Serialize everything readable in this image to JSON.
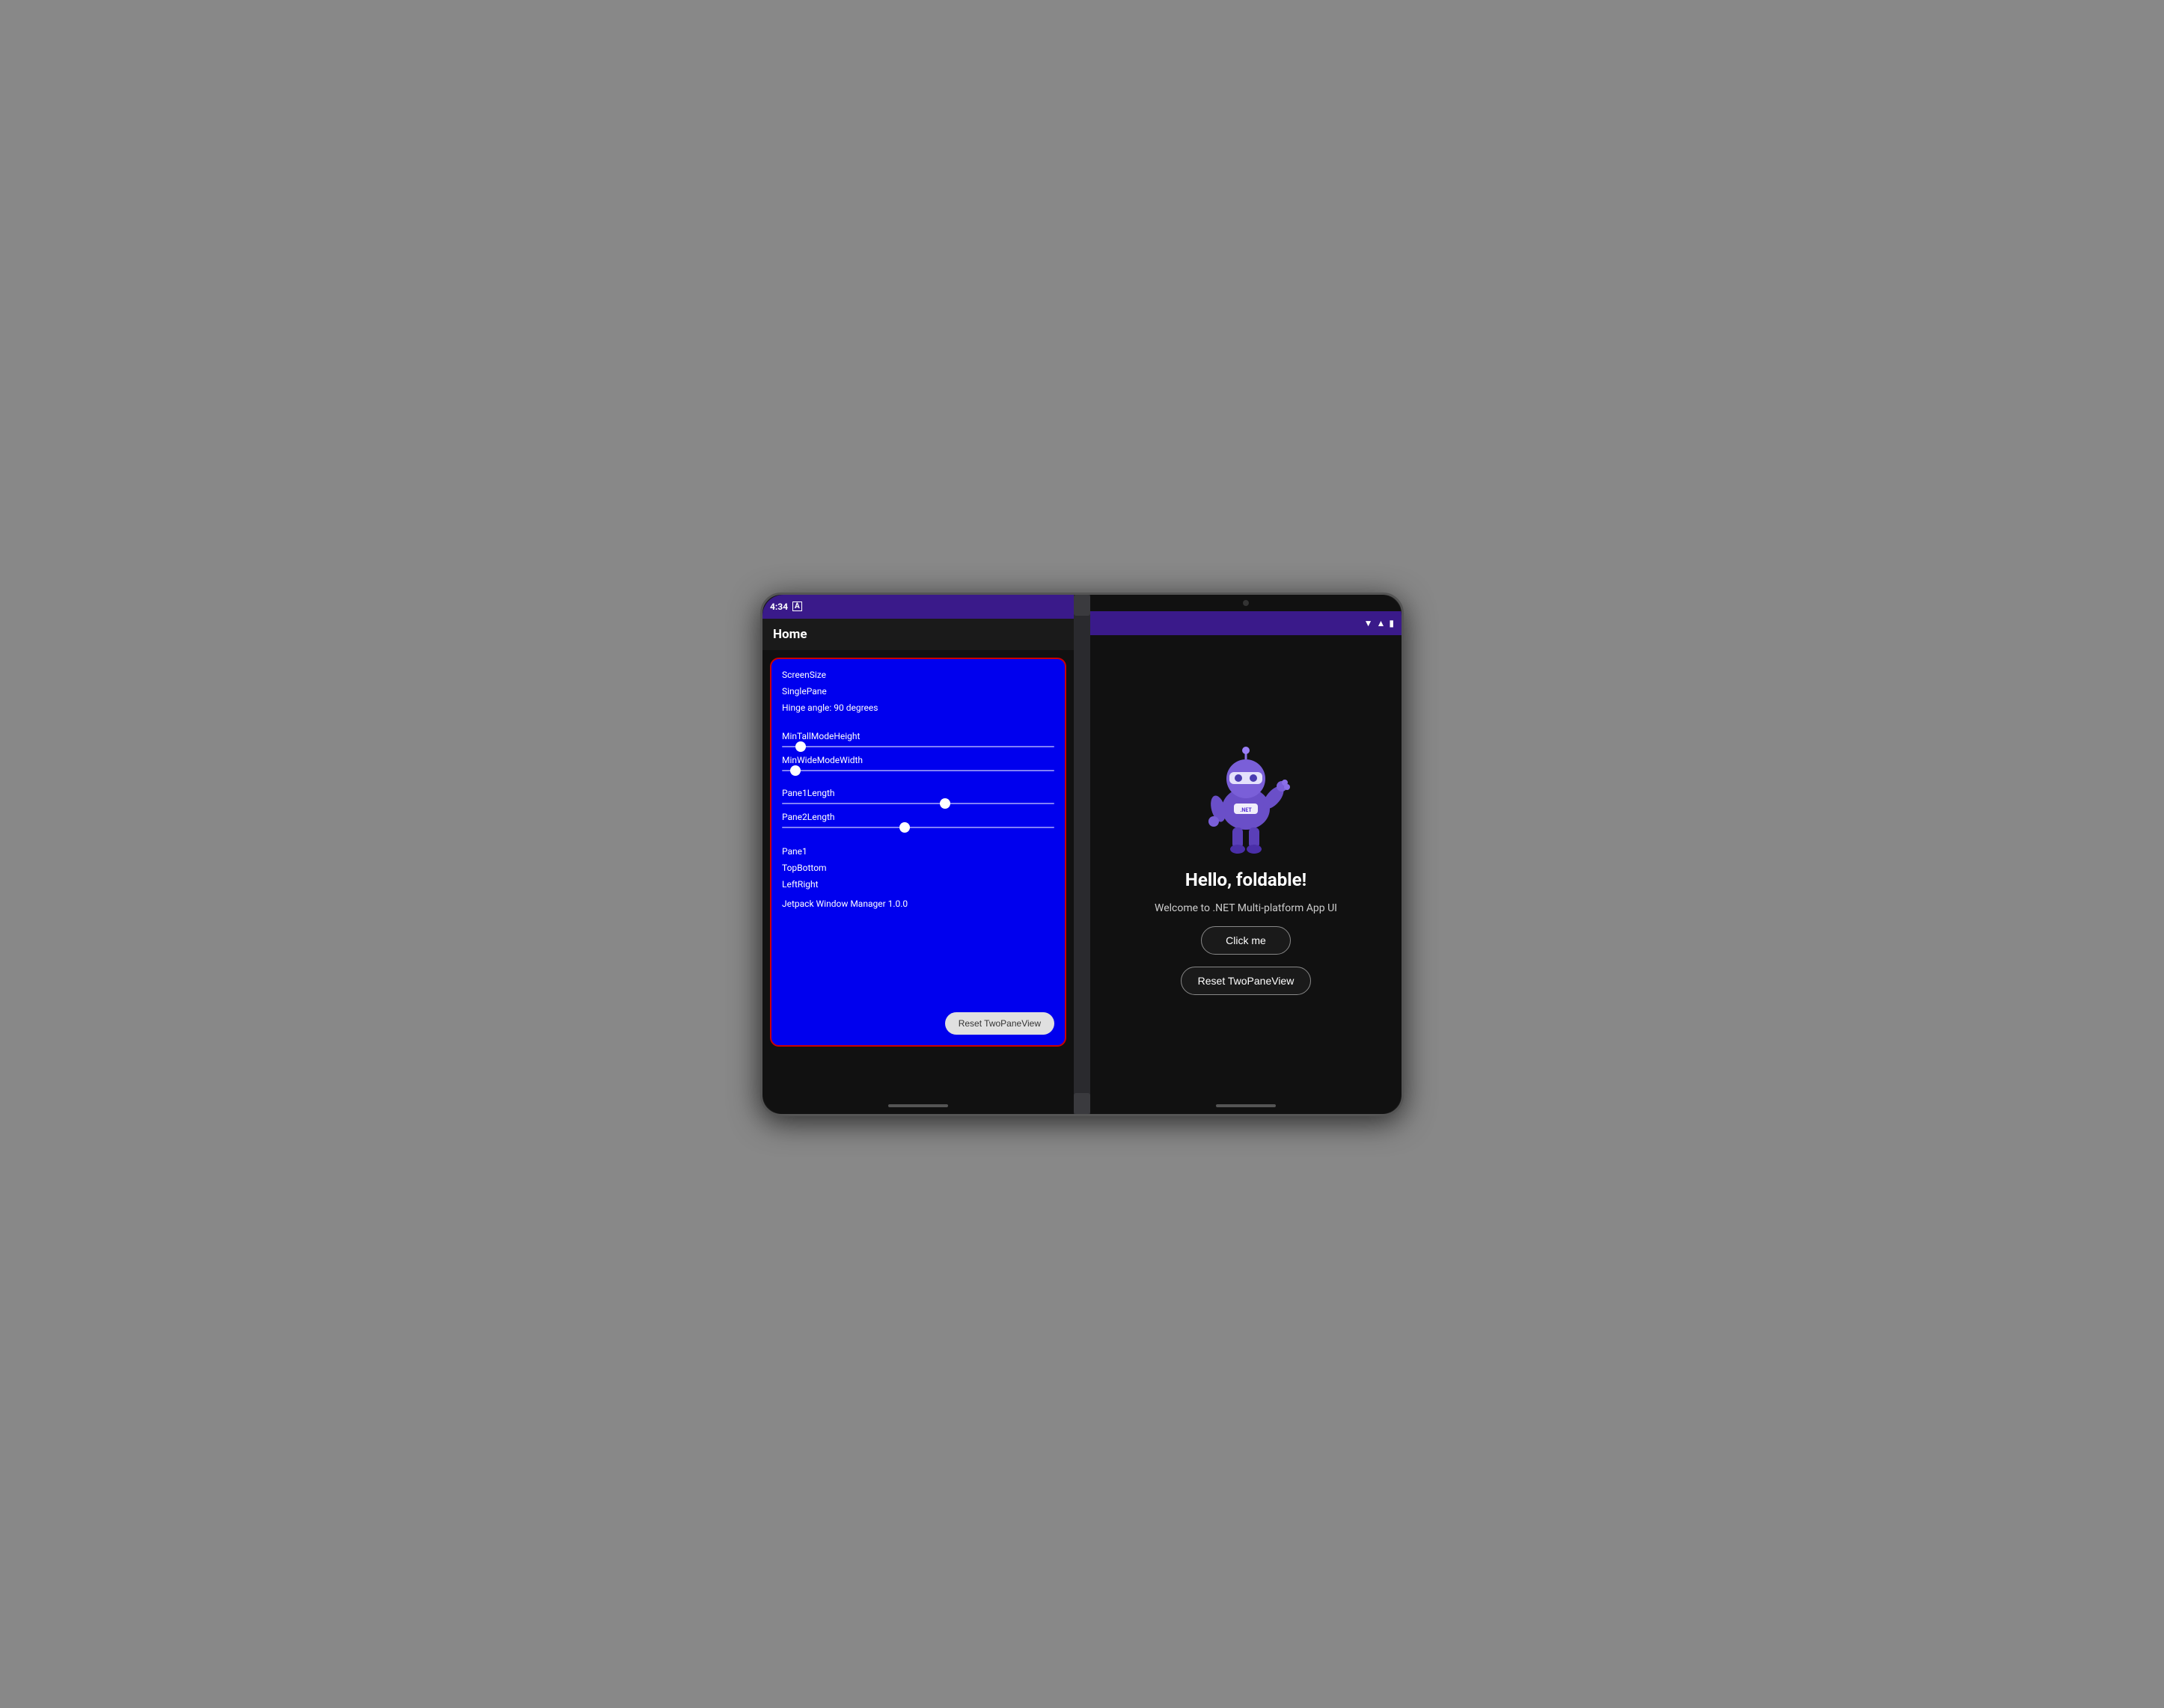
{
  "device": {
    "left_pane": {
      "status_bar": {
        "time": "4:34",
        "icon_a": "A"
      },
      "app_bar": {
        "title": "Home"
      },
      "pane1_info": {
        "screen_size": "ScreenSize",
        "single_pane": "SinglePane",
        "hinge_angle": "Hinge angle: 90 degrees"
      },
      "sliders": [
        {
          "label": "MinTallModeHeight",
          "thumb_pos": "5%"
        },
        {
          "label": "MinWideModeWidth",
          "thumb_pos": "3%"
        },
        {
          "label": "Pane1Length",
          "thumb_pos": "58%"
        },
        {
          "label": "Pane2Length",
          "thumb_pos": "43%"
        }
      ],
      "pane_label": "Pane1",
      "layout_labels": [
        "TopBottom",
        "LeftRight"
      ],
      "version_label": "Jetpack Window Manager 1.0.0",
      "reset_button": "Reset TwoPaneView"
    },
    "right_pane": {
      "camera": "camera",
      "hello_text": "Hello, foldable!",
      "welcome_text": "Welcome to .NET Multi-platform App UI",
      "click_button": "Click me",
      "reset_button": "Reset TwoPaneView"
    }
  }
}
